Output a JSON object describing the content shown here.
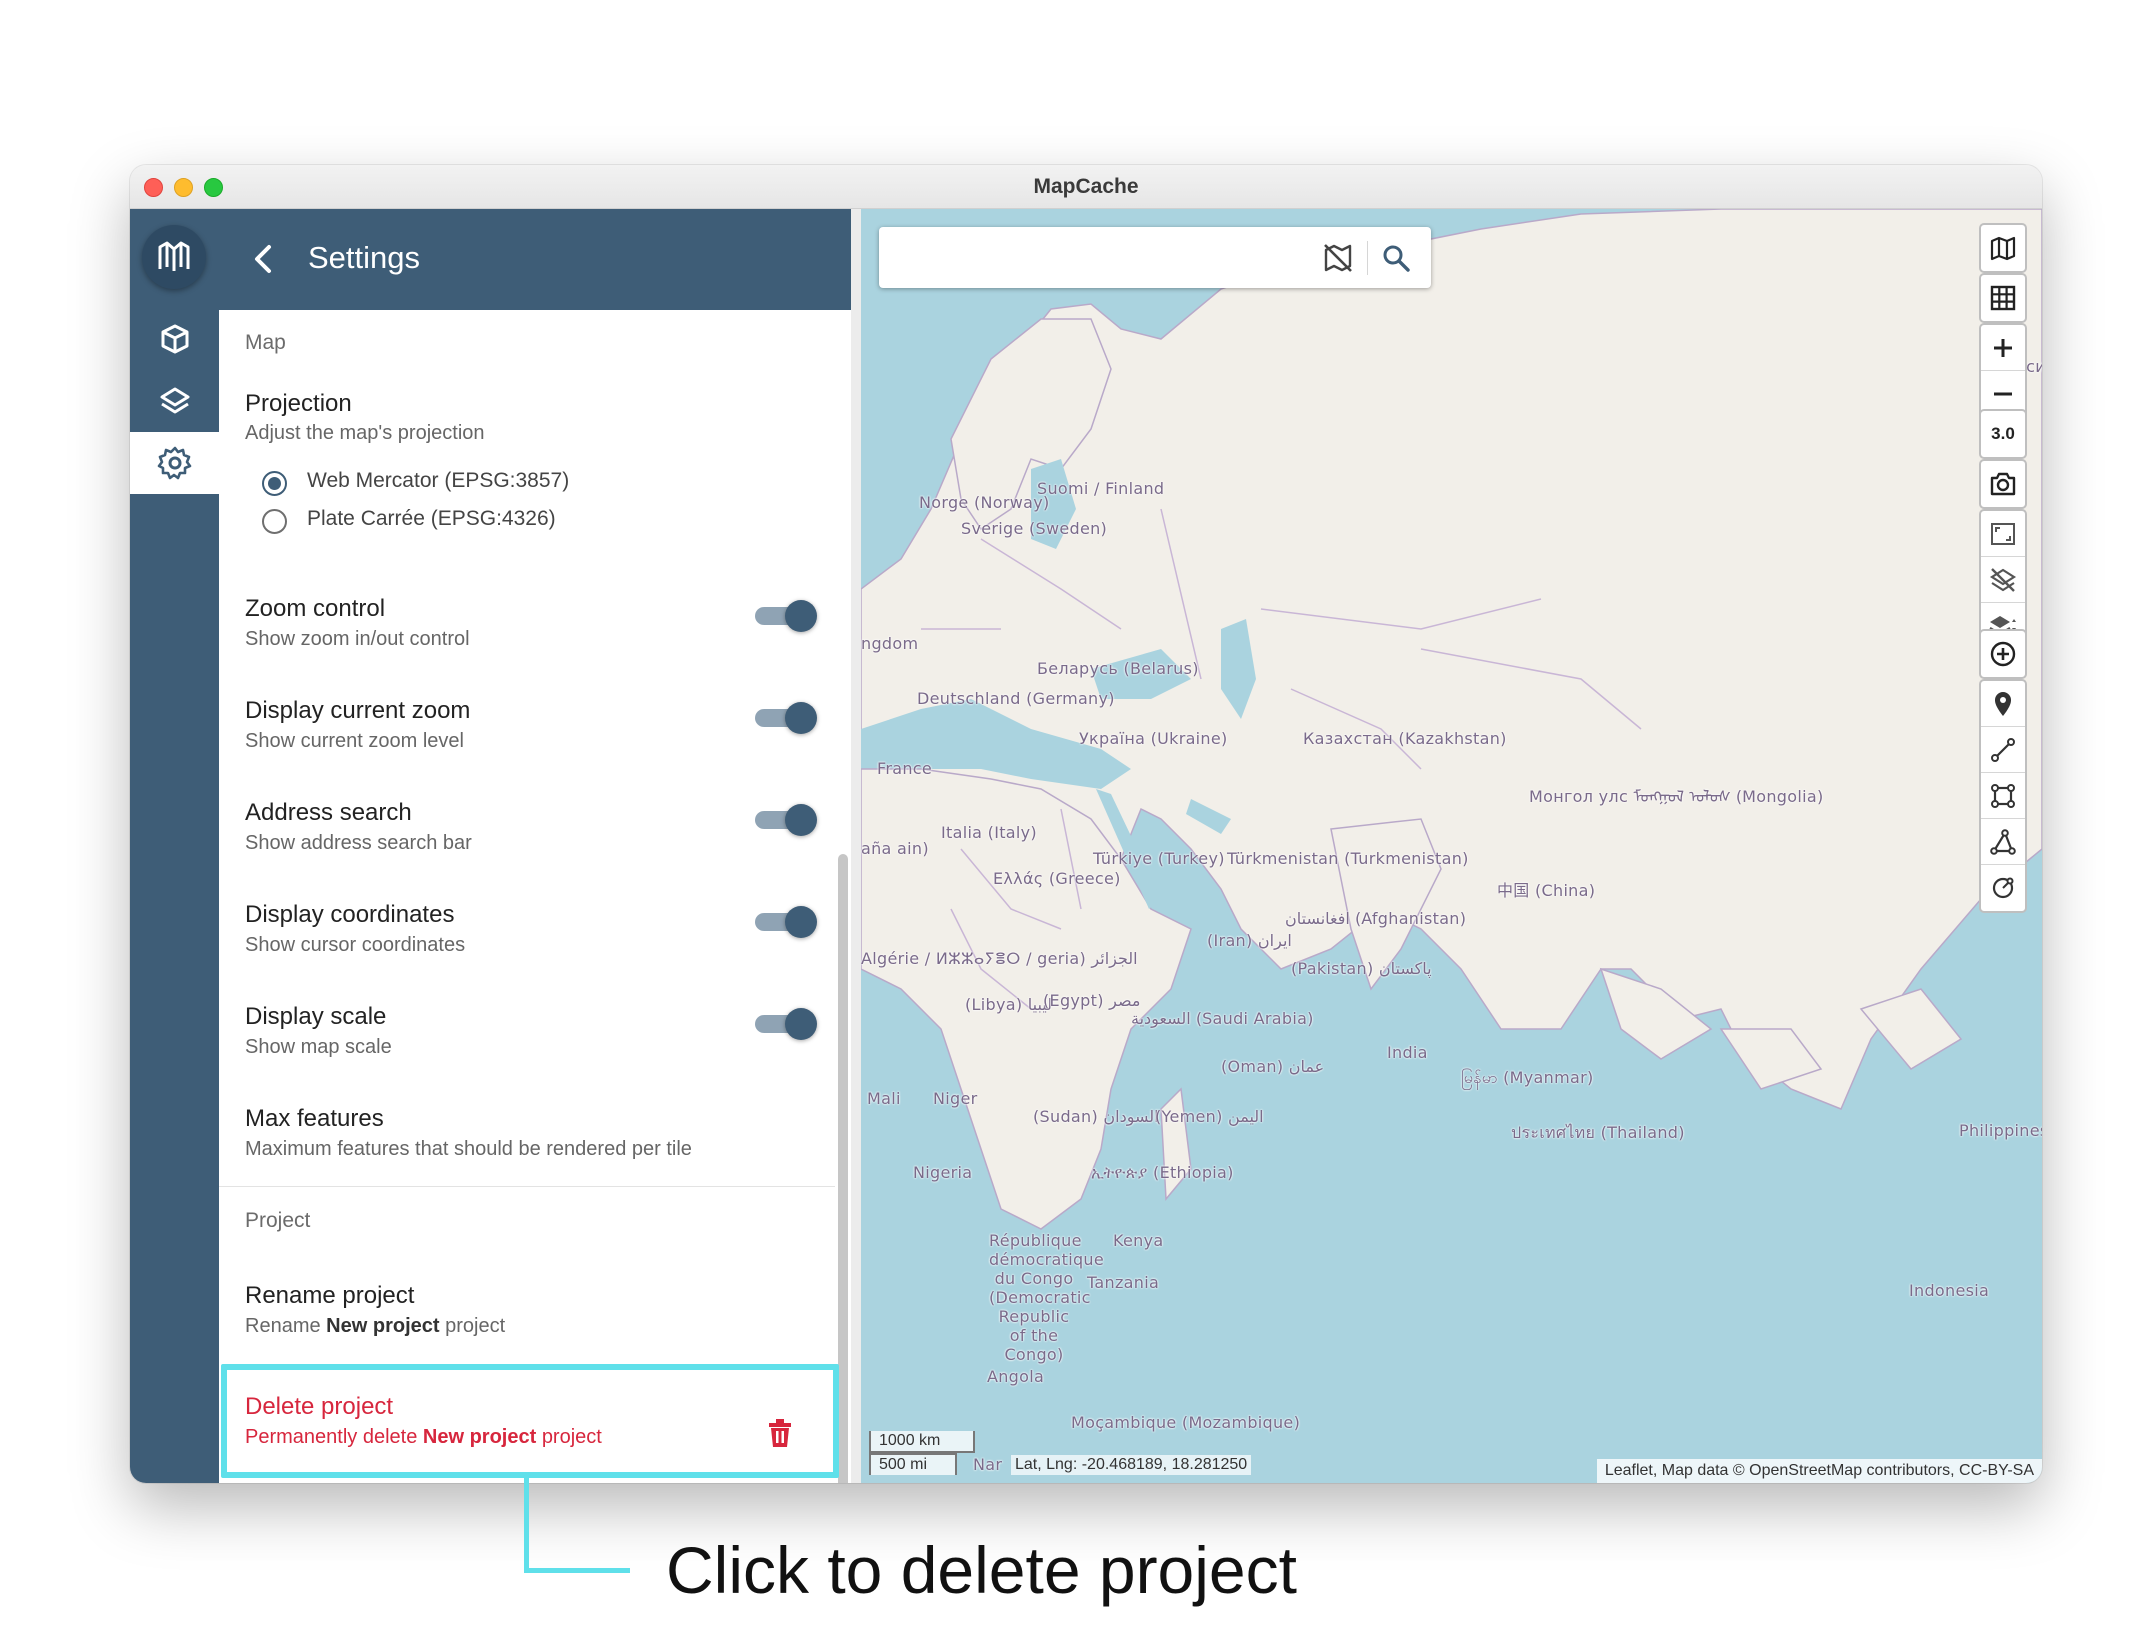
{
  "window": {
    "title": "MapCache"
  },
  "rail": {
    "items": [
      "projects-icon",
      "layers-icon",
      "settings-icon"
    ],
    "active": "settings"
  },
  "panel": {
    "title": "Settings",
    "map_section": "Map",
    "projection": {
      "title": "Projection",
      "subtitle": "Adjust the map's projection",
      "options": [
        "Web Mercator (EPSG:3857)",
        "Plate Carrée (EPSG:4326)"
      ],
      "selected": "Web Mercator (EPSG:3857)"
    },
    "settings": [
      {
        "title": "Zoom control",
        "subtitle": "Show zoom in/out control",
        "enabled": true
      },
      {
        "title": "Display current zoom",
        "subtitle": "Show current zoom level",
        "enabled": true
      },
      {
        "title": "Address search",
        "subtitle": "Show address search bar",
        "enabled": true
      },
      {
        "title": "Display coordinates",
        "subtitle": "Show cursor coordinates",
        "enabled": true
      },
      {
        "title": "Display scale",
        "subtitle": "Show map scale",
        "enabled": true
      }
    ],
    "max_features": {
      "title": "Max features",
      "subtitle": "Maximum features that should be rendered per tile"
    },
    "project_section": "Project",
    "rename": {
      "title": "Rename project",
      "sub_prefix": "Rename",
      "project_name": "New project",
      "sub_suffix": "project"
    },
    "delete": {
      "title": "Delete project",
      "sub_prefix": "Permanently delete",
      "project_name": "New project",
      "sub_suffix": "project"
    }
  },
  "map": {
    "search": {
      "placeholder": "",
      "value": ""
    },
    "zoom_level": "3.0",
    "scale": {
      "metric": "1000 km",
      "imperial": "500 mi"
    },
    "coordinates": "Lat, Lng: -20.468189, 18.281250",
    "attribution": "Leaflet, Map data © OpenStreetMap contributors, CC-BY-SA",
    "labels": [
      "Norge (Norway)",
      "Suomi / Finland",
      "Sverige (Sweden)",
      "Россия (Ru",
      "ngdom",
      "Беларусь (Belarus)",
      "Deutschland (Germany)",
      "Україна (Ukraine)",
      "France",
      "Казахстан (Kazakhstan)",
      "Монгол улс ᠮᠣᠩᠭᠣᠯ ᠤᠯᠤᠰ (Mongolia)",
      "Italia (Italy)",
      "aña ain)",
      "Türkiye (Turkey)",
      "Ελλάς (Greece)",
      "Türkmenistan (Turkmenistan)",
      "中国 (China)",
      "افغانستان (Afghanistan)",
      "(Iran) ایران",
      "(Pakistan) پاکستان",
      "Algérie / ⵍⵣⵣⴰⵢⴻⵔ / geria) الجزائر",
      "(Libya) ليبيا",
      "(Egypt) مصر",
      "السعودية (Saudi Arabia)",
      "India",
      "(Oman) عمان",
      "မြန်မာ (Myanmar)",
      "Philippines",
      "Mali",
      "Niger",
      "(Sudan) السودان",
      "(Yemen) اليمن",
      "ประเทศไทย (Thailand)",
      "Nigeria",
      "ኢትዮጵያ (Ethiopia)",
      "Kenya",
      "République démocratique du Congo (Democratic Republic of the Congo)",
      "Tanzania",
      "Angola",
      "Indonesia",
      "Moçambique (Mozambique)",
      "Nar"
    ],
    "controls": [
      "map-icon",
      "grid-icon",
      "zoom-in",
      "zoom-out",
      "zoom-level",
      "camera-icon",
      "fit-icon",
      "layers-off-icon",
      "layers-toggle-icon",
      "add-circle-icon",
      "marker-icon",
      "line-icon",
      "polygon-icon",
      "measure-icon",
      "rotate-icon"
    ]
  },
  "callout": {
    "text": "Click to delete project"
  },
  "colors": {
    "primary": "#3e5d77",
    "danger": "#d7263d",
    "highlight": "#5fe0ea",
    "water": "#aad3df",
    "land": "#f2efe9"
  }
}
